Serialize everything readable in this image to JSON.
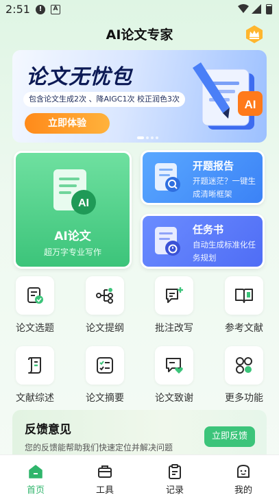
{
  "status_bar": {
    "time": "2:51",
    "alert_glyph": "!",
    "a_glyph": "A",
    "icons": [
      "alert-icon",
      "a-icon",
      "wifi-icon",
      "signal-icon",
      "battery-icon"
    ]
  },
  "header": {
    "title": "AI论文专家",
    "vip_icon": "crown-icon"
  },
  "banner": {
    "title": "论文无忧包",
    "description": "包含论文生成2次 、降AIGC1次  校正润色3次",
    "cta_label": "立即体验",
    "art_badge": "AI",
    "accent": "#ff8a1a"
  },
  "cards": {
    "ai_paper": {
      "title": "AI论文",
      "subtitle": "超万字专业写作",
      "badge": "AI",
      "color": "#3cc47a"
    },
    "proposal": {
      "title": "开题报告",
      "subtitle": "开题迷茫？一键生成清晰框架",
      "icon": "search-doc-icon",
      "color": "#4a94fb"
    },
    "task_book": {
      "title": "任务书",
      "subtitle": "自动生成标准化任务规划",
      "icon": "timer-doc-icon",
      "color": "#5b7af7"
    }
  },
  "tools": [
    {
      "label": "论文选题",
      "icon": "doc-check-icon"
    },
    {
      "label": "论文提纲",
      "icon": "outline-tree-icon"
    },
    {
      "label": "批注改写",
      "icon": "comment-add-icon"
    },
    {
      "label": "参考文献",
      "icon": "open-book-icon"
    },
    {
      "label": "文献综述",
      "icon": "scroll-icon"
    },
    {
      "label": "论文摘要",
      "icon": "checklist-icon"
    },
    {
      "label": "论文致谢",
      "icon": "heart-message-icon"
    },
    {
      "label": "更多功能",
      "icon": "grid-more-icon"
    }
  ],
  "feedback": {
    "title": "反馈意见",
    "description": "您的反馈能帮助我们快速定位并解决问题",
    "button_label": "立即反馈"
  },
  "bottom_nav": [
    {
      "label": "首页",
      "icon": "home-icon",
      "active": true
    },
    {
      "label": "工具",
      "icon": "toolbox-icon",
      "active": false
    },
    {
      "label": "记录",
      "icon": "clipboard-icon",
      "active": false
    },
    {
      "label": "我的",
      "icon": "profile-icon",
      "active": false
    }
  ],
  "colors": {
    "primary_green": "#3cc47a",
    "nav_active": "#2fb56b",
    "icon_dark": "#2a2a2a"
  }
}
